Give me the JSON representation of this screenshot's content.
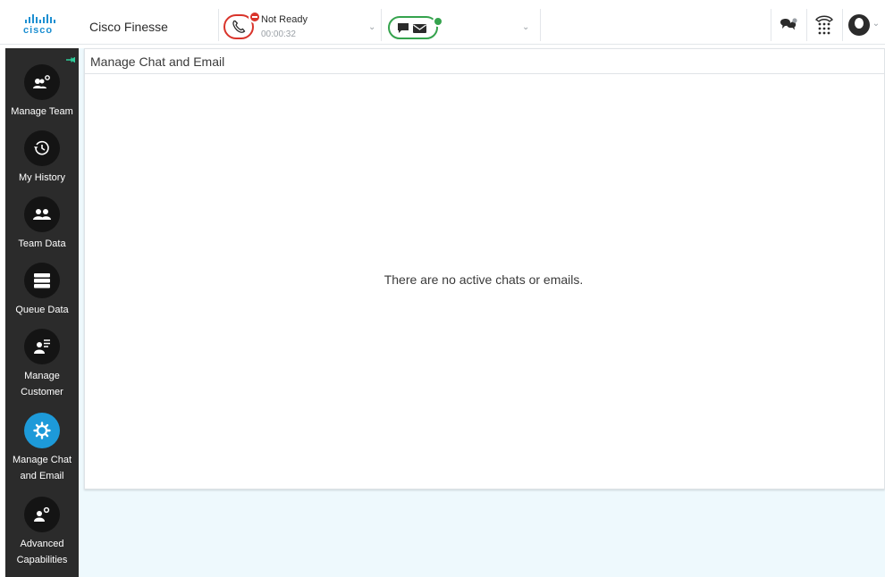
{
  "header": {
    "logo_text": "cisco",
    "app_title": "Cisco Finesse",
    "voice_state": {
      "label": "Not Ready",
      "timer": "00:00:32"
    },
    "icons": [
      "chat-bubbles-icon",
      "dialpad-icon",
      "user-avatar-icon"
    ]
  },
  "sidebar": {
    "items": [
      {
        "label": "Manage Team",
        "icon": "team-settings-icon"
      },
      {
        "label": "My History",
        "icon": "history-icon"
      },
      {
        "label": "Team Data",
        "icon": "team-icon"
      },
      {
        "label": "Queue Data",
        "icon": "queue-list-icon"
      },
      {
        "label": "Manage\nCustomer",
        "icon": "customer-icon"
      },
      {
        "label": "Manage Chat\nand Email",
        "icon": "gear-icon"
      },
      {
        "label": "Advanced\nCapabilities",
        "icon": "agent-gear-icon"
      }
    ]
  },
  "main": {
    "panel_title": "Manage Chat and Email",
    "empty_message": "There are no active chats or emails."
  },
  "colors": {
    "accent": "#1d9ad9",
    "not_ready": "#d9342b",
    "ready": "#35a34d",
    "sidebar_bg": "#2b2b2b",
    "content_bg": "#eef9fd"
  }
}
